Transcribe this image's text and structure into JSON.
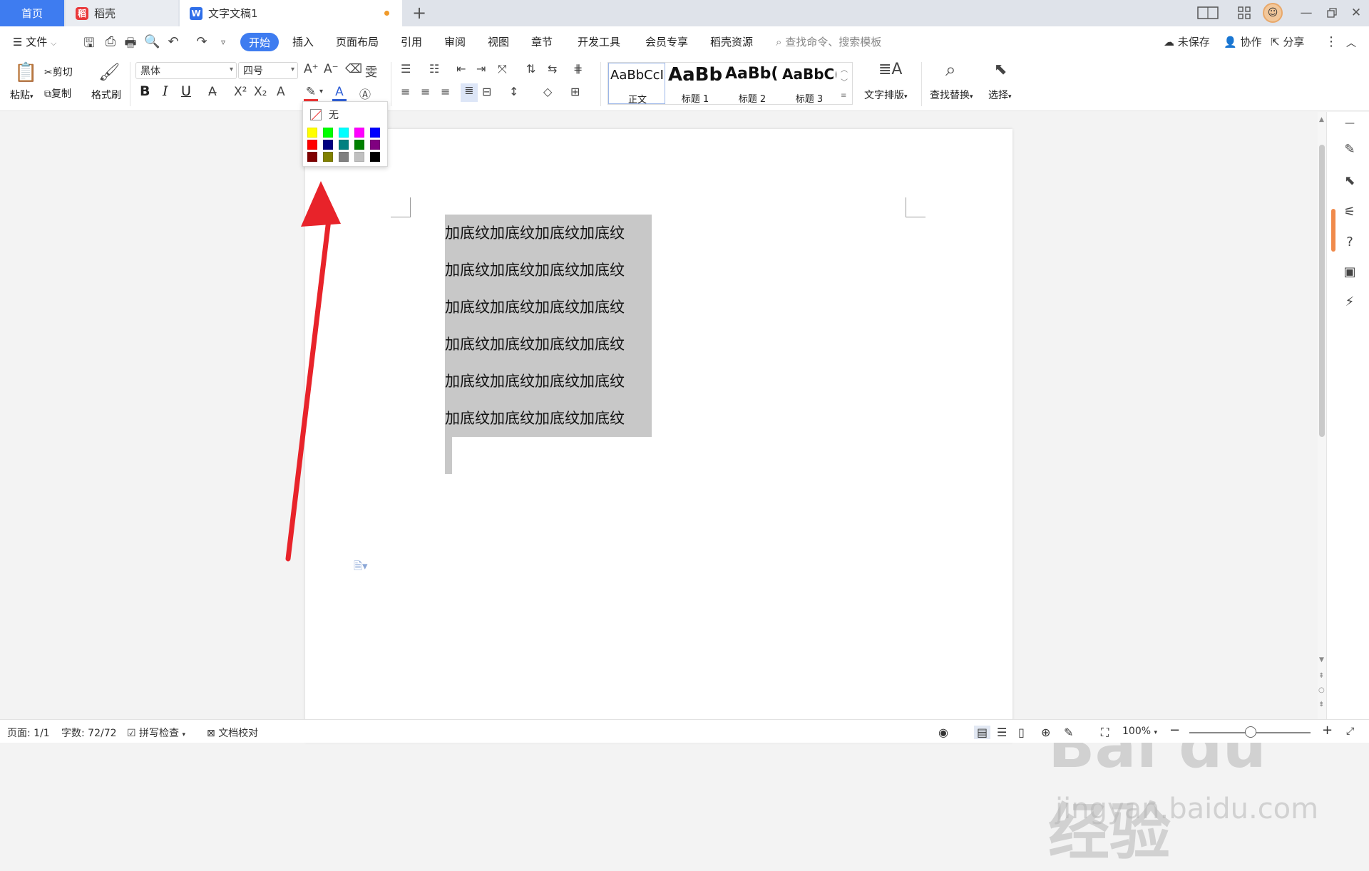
{
  "tabs": {
    "home": "首页",
    "daoke": "稻壳",
    "doc": "文字文稿1",
    "add": "+"
  },
  "menu": {
    "file": "文件",
    "items": [
      "开始",
      "插入",
      "页面布局",
      "引用",
      "审阅",
      "视图",
      "章节",
      "开发工具",
      "会员专享",
      "稻壳资源"
    ],
    "search": "查找命令、搜索模板",
    "unsaved": "未保存",
    "collab": "协作",
    "share": "分享"
  },
  "ribbon": {
    "paste": "粘贴",
    "cut": "剪切",
    "copy": "复制",
    "format_painter": "格式刷",
    "font_name": "黑体",
    "font_size": "四号",
    "bold": "B",
    "italic": "I",
    "underline": "U",
    "styles": [
      {
        "sample": "AaBbCcI",
        "label": "正文"
      },
      {
        "sample": "AaBb",
        "label": "标题 1"
      },
      {
        "sample": "AaBb(",
        "label": "标题 2"
      },
      {
        "sample": "AaBbC(",
        "label": "标题 3"
      }
    ],
    "text_layout": "文字排版",
    "find_replace": "查找替换",
    "select": "选择"
  },
  "dropdown": {
    "none_label": "无",
    "colors": [
      [
        "#ffff00",
        "#00ff00",
        "#00ffff",
        "#ff00ff",
        "#0000ff"
      ],
      [
        "#ff0000",
        "#000080",
        "#008080",
        "#008000",
        "#800080"
      ],
      [
        "#800000",
        "#808000",
        "#808080",
        "#c0c0c0",
        "#000000"
      ]
    ]
  },
  "document": {
    "lines": [
      "加底纹加底纹加底纹加底纹",
      "加底纹加底纹加底纹加底纹",
      "加底纹加底纹加底纹加底纹",
      "加底纹加底纹加底纹加底纹",
      "加底纹加底纹加底纹加底纹",
      "加底纹加底纹加底纹加底纹"
    ],
    "highlight_color": "#c8c8c8"
  },
  "status": {
    "page": "页面: 1/1",
    "words": "字数: 72/72",
    "spell": "拼写检查",
    "proof": "文档校对",
    "zoom": "100%"
  },
  "watermark": {
    "main": "Bai du 经验",
    "sub": "jingyan.baidu.com"
  },
  "annotation": {
    "arrow_color": "#e8232a"
  }
}
